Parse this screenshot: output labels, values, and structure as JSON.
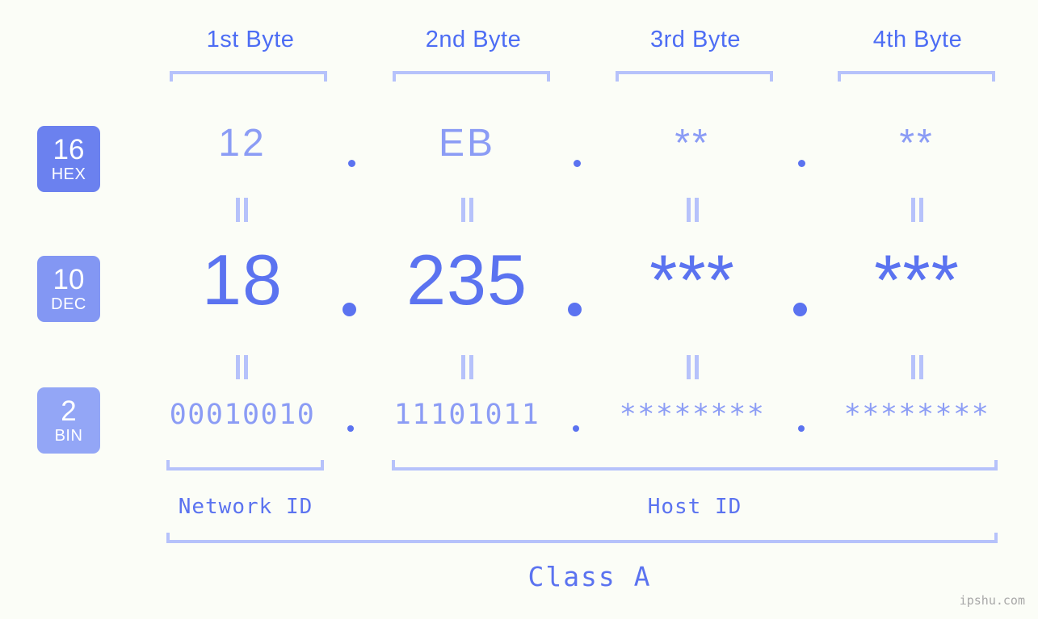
{
  "theme": {
    "background": "#fbfdf7",
    "accent_strong": "#5b73f0",
    "accent_mid": "#8b9cf5",
    "accent_light": "#b6c2fb",
    "badge_hex": "#6b81ef",
    "badge_dec": "#8397f3",
    "badge_bin": "#93a6f6"
  },
  "header": {
    "bytes": [
      {
        "label": "1st Byte"
      },
      {
        "label": "2nd Byte"
      },
      {
        "label": "3rd Byte"
      },
      {
        "label": "4th Byte"
      }
    ]
  },
  "bases": [
    {
      "number": "16",
      "name": "HEX"
    },
    {
      "number": "10",
      "name": "DEC"
    },
    {
      "number": "2",
      "name": "BIN"
    }
  ],
  "rows": {
    "hex": {
      "base": "16",
      "base_name": "HEX",
      "values": [
        "12",
        "EB",
        "**",
        "**"
      ],
      "separator": "."
    },
    "dec": {
      "base": "10",
      "base_name": "DEC",
      "values": [
        "18",
        "235",
        "***",
        "***"
      ],
      "separator": "."
    },
    "bin": {
      "base": "2",
      "base_name": "BIN",
      "values": [
        "00010010",
        "11101011",
        "********",
        "********"
      ],
      "separator": "."
    }
  },
  "connectors": {
    "glyph": "||",
    "rows": 2,
    "per_row": 4
  },
  "footer": {
    "network_id": "Network ID",
    "host_id": "Host ID",
    "class": "Class A"
  },
  "watermark": "ipshu.com"
}
